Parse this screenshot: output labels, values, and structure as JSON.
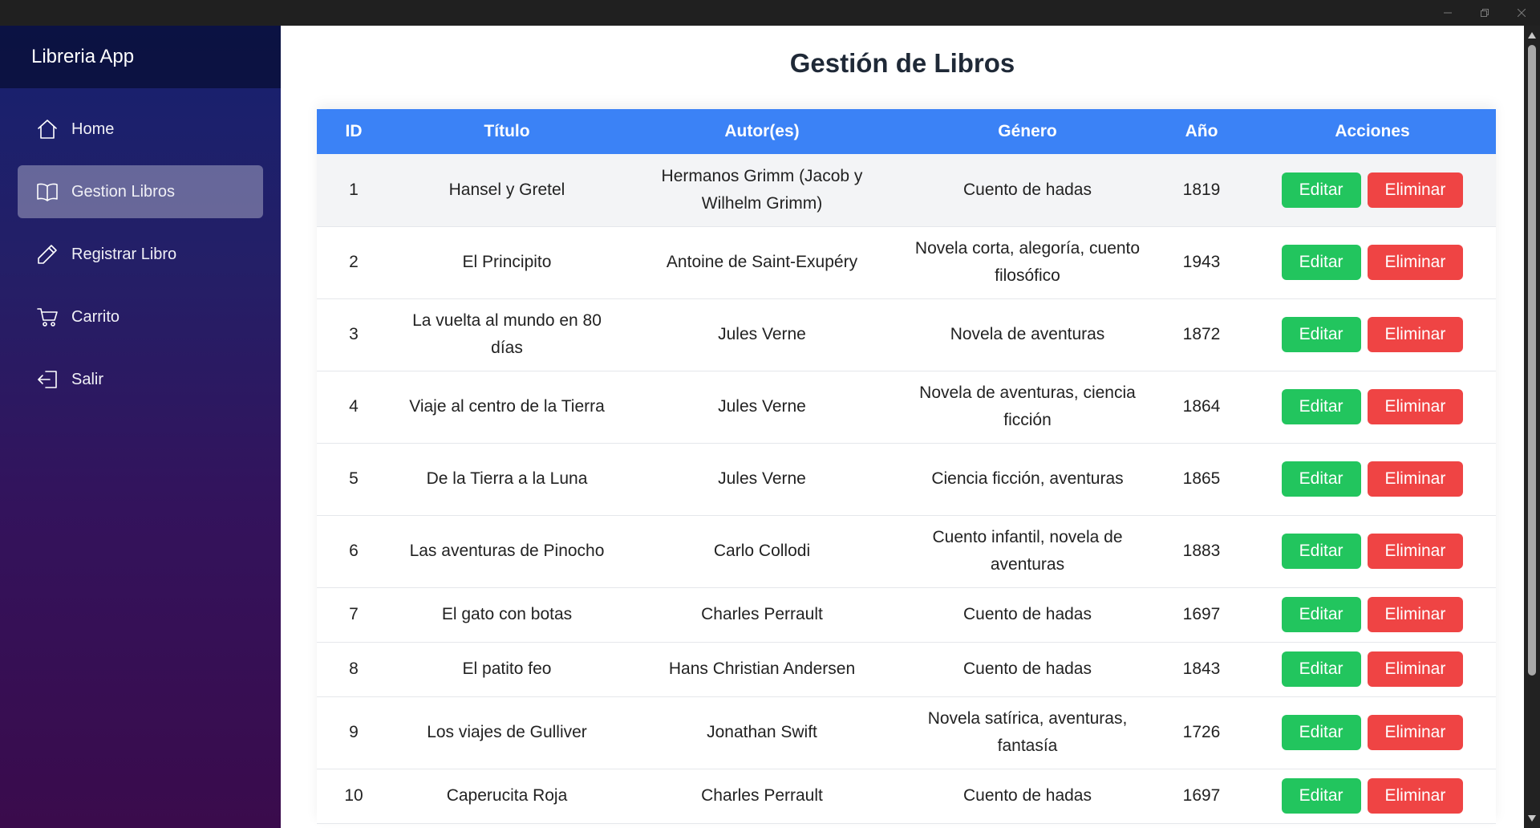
{
  "window": {
    "controls": [
      "minimize",
      "restore",
      "close"
    ]
  },
  "sidebar": {
    "app_title": "Libreria App",
    "items": [
      {
        "label": "Home",
        "icon": "home-icon",
        "active": false
      },
      {
        "label": "Gestion Libros",
        "icon": "book-icon",
        "active": true
      },
      {
        "label": "Registrar Libro",
        "icon": "pencil-icon",
        "active": false
      },
      {
        "label": "Carrito",
        "icon": "cart-icon",
        "active": false
      },
      {
        "label": "Salir",
        "icon": "logout-icon",
        "active": false
      }
    ]
  },
  "main": {
    "title": "Gestión de Libros",
    "table": {
      "headers": [
        "ID",
        "Título",
        "Autor(es)",
        "Género",
        "Año",
        "Acciones"
      ],
      "edit_label": "Editar",
      "delete_label": "Eliminar",
      "rows": [
        {
          "id": "1",
          "titulo": "Hansel y Gretel",
          "autor": "Hermanos Grimm (Jacob y Wilhelm Grimm)",
          "genero": "Cuento de hadas",
          "anio": "1819"
        },
        {
          "id": "2",
          "titulo": "El Principito",
          "autor": "Antoine de Saint-Exupéry",
          "genero": "Novela corta, alegoría, cuento filosófico",
          "anio": "1943"
        },
        {
          "id": "3",
          "titulo": "La vuelta al mundo en 80 días",
          "autor": "Jules Verne",
          "genero": "Novela de aventuras",
          "anio": "1872"
        },
        {
          "id": "4",
          "titulo": "Viaje al centro de la Tierra",
          "autor": "Jules Verne",
          "genero": "Novela de aventuras, ciencia ficción",
          "anio": "1864"
        },
        {
          "id": "5",
          "titulo": "De la Tierra a la Luna",
          "autor": "Jules Verne",
          "genero": "Ciencia ficción, aventuras",
          "anio": "1865"
        },
        {
          "id": "6",
          "titulo": "Las aventuras de Pinocho",
          "autor": "Carlo Collodi",
          "genero": "Cuento infantil, novela de aventuras",
          "anio": "1883"
        },
        {
          "id": "7",
          "titulo": "El gato con botas",
          "autor": "Charles Perrault",
          "genero": "Cuento de hadas",
          "anio": "1697"
        },
        {
          "id": "8",
          "titulo": "El patito feo",
          "autor": "Hans Christian Andersen",
          "genero": "Cuento de hadas",
          "anio": "1843"
        },
        {
          "id": "9",
          "titulo": "Los viajes de Gulliver",
          "autor": "Jonathan Swift",
          "genero": "Novela satírica, aventuras, fantasía",
          "anio": "1726"
        },
        {
          "id": "10",
          "titulo": "Caperucita Roja",
          "autor": "Charles Perrault",
          "genero": "Cuento de hadas",
          "anio": "1697"
        }
      ]
    }
  },
  "colors": {
    "header_blue": "#3b82f6",
    "edit_green": "#22c55e",
    "delete_red": "#ef4444"
  }
}
